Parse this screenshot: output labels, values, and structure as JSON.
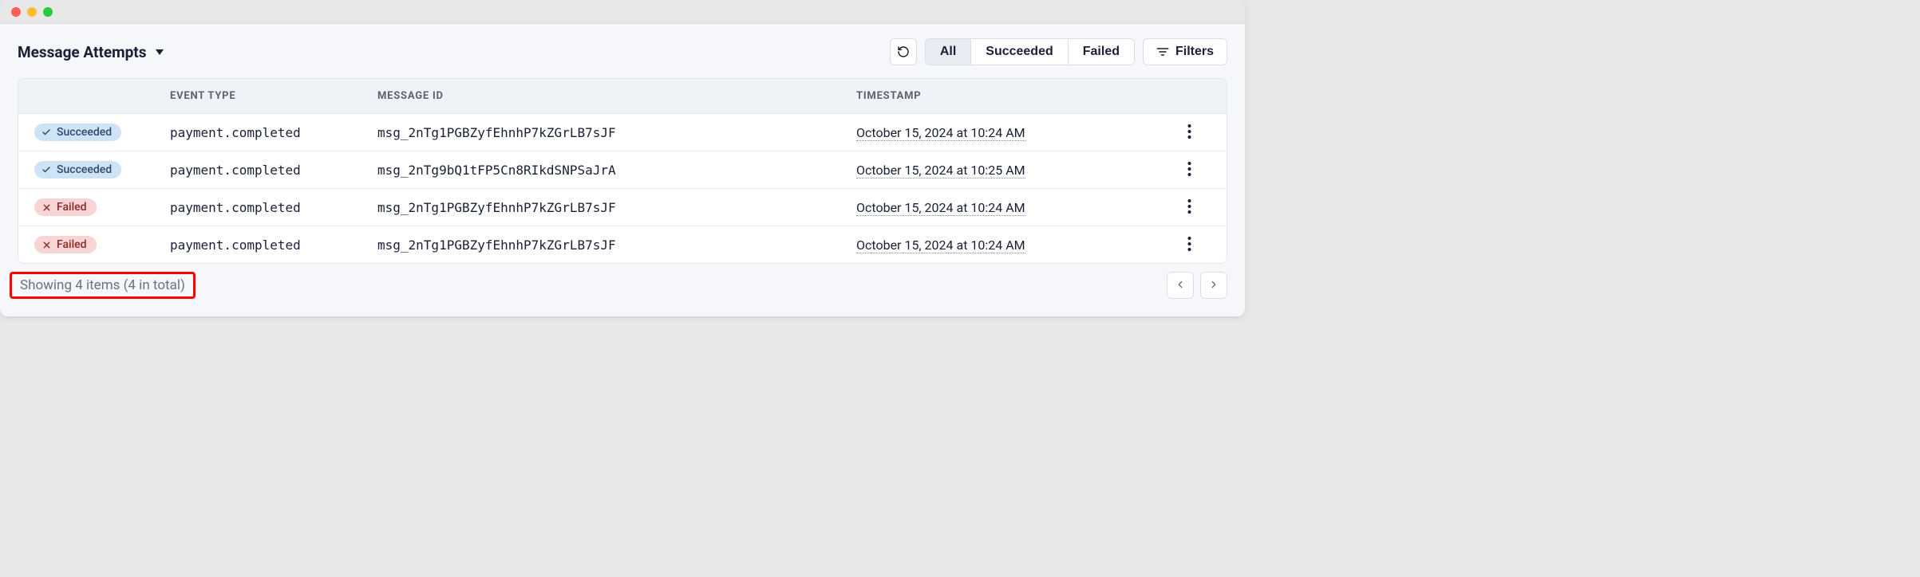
{
  "header": {
    "title": "Message Attempts",
    "filters_label": "Filters",
    "segmented": {
      "all": "All",
      "succeeded": "Succeeded",
      "failed": "Failed"
    }
  },
  "columns": {
    "event_type": "Event Type",
    "message_id": "Message ID",
    "timestamp": "Timestamp"
  },
  "status_labels": {
    "succeeded": "Succeeded",
    "failed": "Failed"
  },
  "rows": [
    {
      "status": "succeeded",
      "event_type": "payment.completed",
      "message_id": "msg_2nTg1PGBZyfEhnhP7kZGrLB7sJF",
      "timestamp": "October 15, 2024 at 10:24 AM"
    },
    {
      "status": "succeeded",
      "event_type": "payment.completed",
      "message_id": "msg_2nTg9bQ1tFP5Cn8RIkdSNPSaJrA",
      "timestamp": "October 15, 2024 at 10:25 AM"
    },
    {
      "status": "failed",
      "event_type": "payment.completed",
      "message_id": "msg_2nTg1PGBZyfEhnhP7kZGrLB7sJF",
      "timestamp": "October 15, 2024 at 10:24 AM"
    },
    {
      "status": "failed",
      "event_type": "payment.completed",
      "message_id": "msg_2nTg1PGBZyfEhnhP7kZGrLB7sJF",
      "timestamp": "October 15, 2024 at 10:24 AM"
    }
  ],
  "footer": {
    "summary": "Showing 4 items (4 in total)"
  }
}
